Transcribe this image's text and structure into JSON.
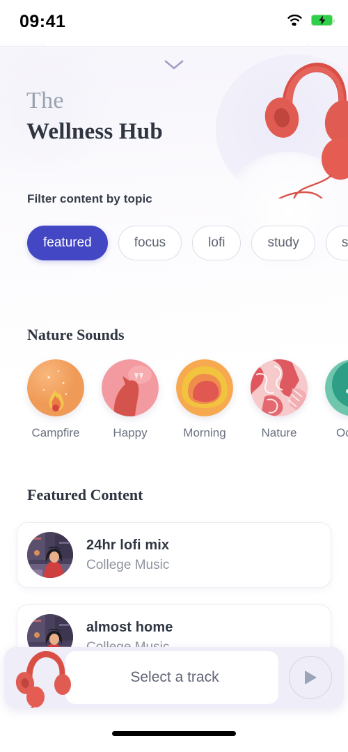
{
  "status_bar": {
    "time": "09:41",
    "wifi_icon": "wifi-icon",
    "battery_icon": "battery-charging-icon"
  },
  "header": {
    "collapse_icon": "chevron-down-icon",
    "title_prefix": "The",
    "title_main": "Wellness Hub",
    "hero_icon": "headphones-illustration"
  },
  "filter": {
    "label": "Filter content by topic",
    "active_color": "#4447c4",
    "chips": [
      {
        "label": "featured",
        "active": true
      },
      {
        "label": "focus",
        "active": false
      },
      {
        "label": "lofi",
        "active": false
      },
      {
        "label": "study",
        "active": false
      },
      {
        "label": "stress",
        "active": false
      }
    ]
  },
  "nature_sounds": {
    "title": "Nature Sounds",
    "items": [
      {
        "label": "Campfire",
        "icon": "campfire-thumbnail",
        "color": "#f2a264"
      },
      {
        "label": "Happy",
        "icon": "cat-thumbnail",
        "color": "#f59aa3"
      },
      {
        "label": "Morning",
        "icon": "sunrise-thumbnail",
        "color": "#f6a94f"
      },
      {
        "label": "Nature",
        "icon": "leaves-thumbnail",
        "color": "#e8707a"
      },
      {
        "label": "Ocean",
        "icon": "ocean-thumbnail",
        "color": "#2f9e86"
      }
    ]
  },
  "featured": {
    "title": "Featured Content",
    "items": [
      {
        "title": "24hr lofi mix",
        "subtitle": "College Music",
        "icon": "lofi-girl-thumbnail"
      },
      {
        "title": "almost home",
        "subtitle": "College Music",
        "icon": "lofi-girl-thumbnail"
      }
    ]
  },
  "player": {
    "status_text": "Select a track",
    "art_icon": "headphones-illustration",
    "play_icon": "play-icon"
  }
}
